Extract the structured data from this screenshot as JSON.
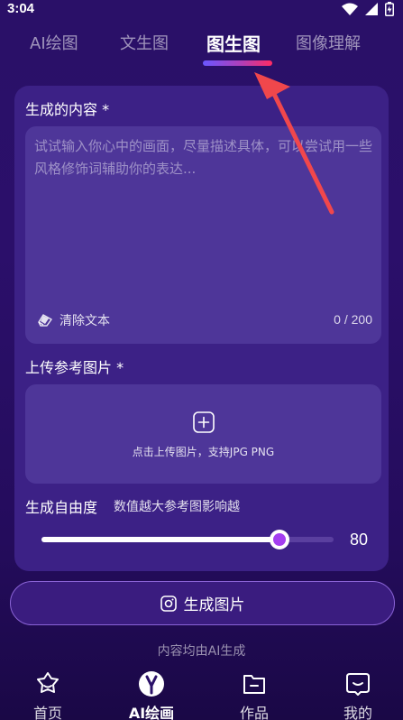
{
  "status_bar": {
    "time": "3:04"
  },
  "tabs": [
    {
      "label": "AI绘图"
    },
    {
      "label": "文生图"
    },
    {
      "label": "图生图"
    },
    {
      "label": "图像理解"
    }
  ],
  "active_tab": "图生图",
  "prompt_section": {
    "label": "生成的内容 *",
    "placeholder": "试试输入你心中的画面，尽量描述具体，可以尝试用一些风格修饰词辅助你的表达...",
    "value": "",
    "clear_label": "清除文本",
    "char_count": "0 / 200"
  },
  "upload_section": {
    "label": "上传参考图片 *",
    "hint": "点击上传图片，支持JPG  PNG"
  },
  "freedom_section": {
    "label": "生成自由度",
    "hint": "数值越大参考图影响越",
    "value": "80",
    "slider_fraction": 0.8
  },
  "generate_button": {
    "label": "生成图片"
  },
  "footer_note": "内容均由AI生成",
  "bottom_nav": [
    {
      "label": "首页"
    },
    {
      "label": "AI绘画"
    },
    {
      "label": "作品"
    },
    {
      "label": "我的"
    }
  ],
  "colors": {
    "accent_purple": "#a43ef0",
    "tab_gradient_start": "#6a57ff",
    "tab_gradient_end": "#ff2b63",
    "arrow_red": "#f0474c"
  }
}
